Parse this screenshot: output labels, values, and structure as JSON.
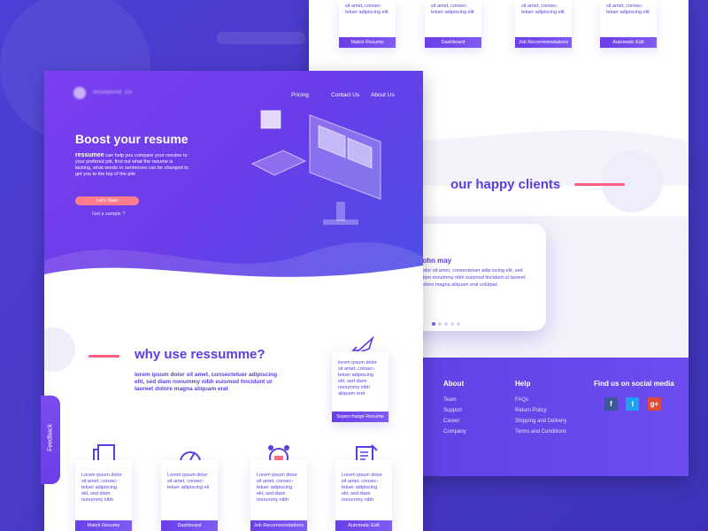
{
  "colors": {
    "brand": "#6a3ee8",
    "accent": "#ff5c7f",
    "text": "#5b3de0"
  },
  "top_cards": [
    {
      "text": "sit amet, consec-\ntetuer adipiscing elit",
      "label": "Match Resume"
    },
    {
      "text": "sit amet, consec-\ntetuer adipiscing elit",
      "label": "Dashboard"
    },
    {
      "text": "sit amet, consec-\ntetuer adipiscing elit",
      "label": "Job Recommendations"
    },
    {
      "text": "sit amet, consec-\ntetuer adipiscing elit",
      "label": "Automatic Edit"
    }
  ],
  "happy_clients_title": "our happy clients",
  "testimonial": {
    "name": "john may",
    "quote": "dolor sit amet, consectetuer adip iscing elit, sed diam nonummy nibh euismod tincidunt ut laoreet dolore magna aliquam erat volutpat."
  },
  "footer": {
    "about_title": "About",
    "about_links": [
      "Team",
      "Support",
      "Career",
      "Company"
    ],
    "help_title": "Help",
    "help_links": [
      "FAQs",
      "Return Policy",
      "Shipping and Delivery",
      "Terms and Conditions"
    ],
    "social_title": "Find us on social media",
    "social_icons": [
      "facebook-icon",
      "twitter-icon",
      "google-plus-icon"
    ]
  },
  "nav": {
    "pricing": "Pricing",
    "contact": "Contact Us",
    "about": "About Us"
  },
  "hero": {
    "title": "Boost your resume",
    "brand": "ressumee",
    "desc": "can help you compare your resume to your prefered job, find out what the resume is lacking, what words or sentences can be changed to get you to the top of the pile",
    "cta": "Let's Start",
    "sample": "Get a sample ?"
  },
  "why": {
    "title": "why use ressumme?",
    "desc": "lorem ipsum dolor sit amet, consectetuer adipiscing elit, sed diam nonummy nibh euismod tincidunt ut laoreet dolore magna aliquam erat"
  },
  "supercharge": {
    "text": "lorem ipsum dolor sit amet, consec-tetuer adipiscing elit, sed diam nonummy nibh aliquam erat",
    "label": "Supercharge Resume"
  },
  "feature_cards": [
    {
      "text": "Lorem ipsum dolor sit amet, consec-tetuer adipiscing elit, sed diam nonummy nibh",
      "label": "Match Resume"
    },
    {
      "text": "Lorem ipsum dolor sit amet, consec-tetuer adipiscing eli",
      "label": "Dashboard"
    },
    {
      "text": "Lorem ipsum dolor sit amet, consec-tetuer adipiscing elit, sed diam nonummy nibh",
      "label": "Job Recommendations"
    },
    {
      "text": "Lorem ipsum dolor sit amet, consec-tetuer adipiscing elit, sed diam nonummy nibh",
      "label": "Automatic Edit"
    }
  ],
  "feedback": "Feedback"
}
